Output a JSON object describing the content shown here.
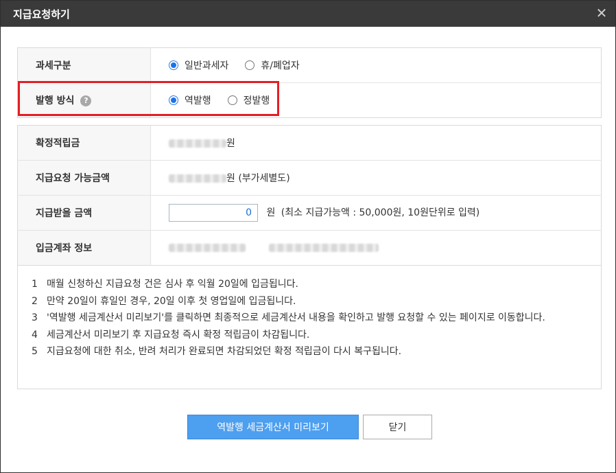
{
  "window": {
    "title": "지급요청하기",
    "close_glyph": "✕"
  },
  "tax_section": {
    "tax_type": {
      "label": "과세구분",
      "options": [
        {
          "label": "일반과세자",
          "checked": true
        },
        {
          "label": "휴/폐업자",
          "checked": false
        }
      ]
    },
    "issue_method": {
      "label": "발행 방식",
      "help_glyph": "?",
      "options": [
        {
          "label": "역발행",
          "checked": true
        },
        {
          "label": "정발행",
          "checked": false
        }
      ]
    }
  },
  "info_section": {
    "confirmed_points": {
      "label": "확정적립금",
      "unit": "원"
    },
    "requestable_amount": {
      "label": "지급요청 가능금액",
      "unit": "원 (부가세별도)"
    },
    "receive_amount": {
      "label": "지급받을 금액",
      "value": "0",
      "unit": "원",
      "note": "(최소 지급가능액 : 50,000원, 10원단위로 입력)"
    },
    "account_info": {
      "label": "입금계좌 정보"
    }
  },
  "notes": [
    {
      "num": "1",
      "text": "매월 신청하신 지급요청 건은 심사 후 익월 20일에 입금됩니다."
    },
    {
      "num": "2",
      "text": "만약 20일이 휴일인 경우, 20일 이후 첫 영업일에 입금됩니다."
    },
    {
      "num": "3",
      "text": "'역발행 세금계산서 미리보기'를 클릭하면 최종적으로 세금계산서 내용을 확인하고 발행 요청할 수 있는 페이지로 이동합니다."
    },
    {
      "num": "4",
      "text": "세금계산서 미리보기 후 지급요청 즉시 확정 적립금이 차감됩니다."
    },
    {
      "num": "5",
      "text": "지급요청에 대한 취소, 반려 처리가 완료되면 차감되었던 확정 적립금이 다시 복구됩니다."
    }
  ],
  "buttons": {
    "preview": "역발행 세금계산서 미리보기",
    "close": "닫기"
  },
  "colors": {
    "titlebar": "#3a3a3a",
    "primary": "#4d9ff0",
    "highlight": "#e31e24",
    "radio": "#1a73e8"
  }
}
